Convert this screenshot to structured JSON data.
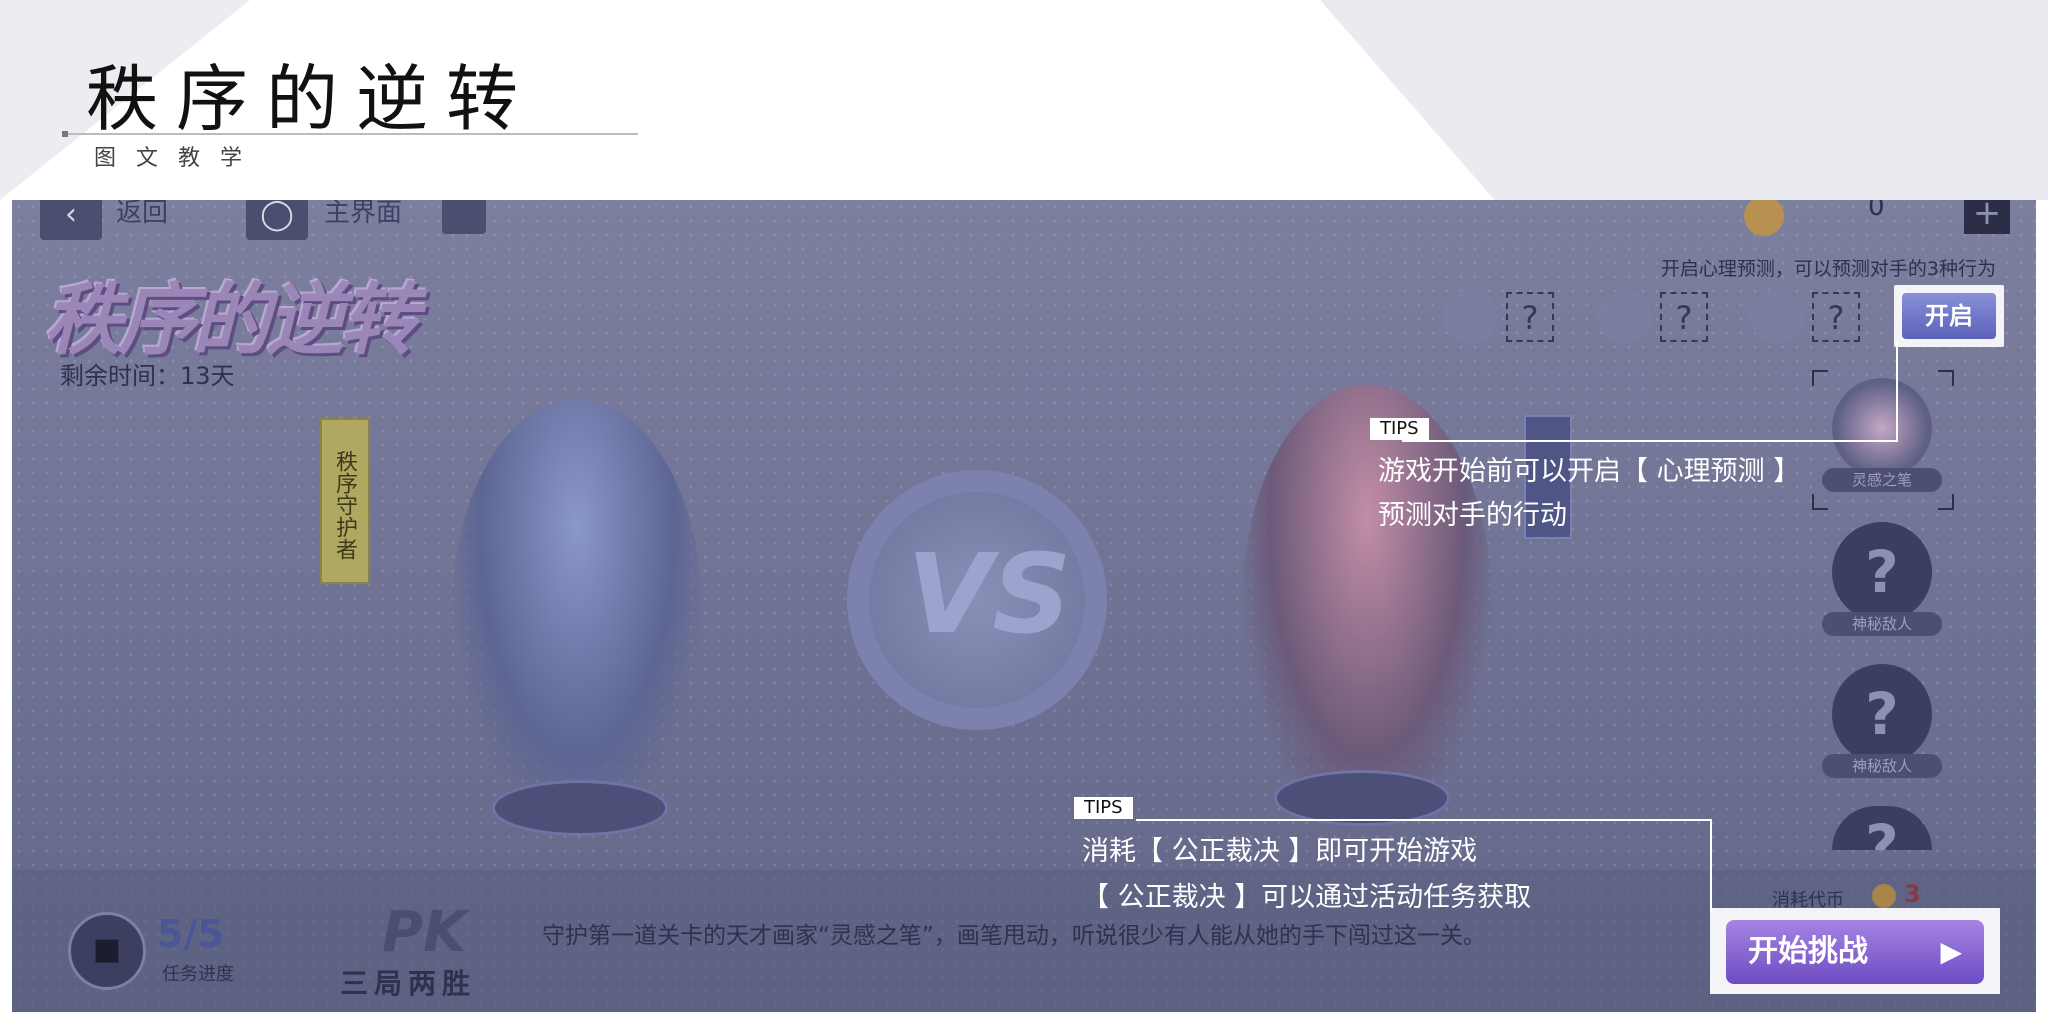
{
  "header": {
    "title": "秩序的逆转",
    "subtitle": "图文教学"
  },
  "topbar": {
    "back_label": "返回",
    "home_label": "主界面",
    "currency_value": "0",
    "plus": "+"
  },
  "event": {
    "logo": "秩序的逆转",
    "remaining": "剩余时间：13天",
    "guardian_tag": "秩序守护者"
  },
  "predict": {
    "hint": "开启心理预测，可以预测对手的3种行为",
    "unknown": "?",
    "open_label": "开启"
  },
  "vs": "VS",
  "enemies": {
    "top_name": "灵感之笔",
    "unknown_mark": "?",
    "unknown_name": "神秘敌人"
  },
  "bottom": {
    "progress": "5/5",
    "progress_label": "任务进度",
    "pk": "PK",
    "mode": "三局两胜",
    "description": "守护第一道关卡的天才画家“灵感之笔”，画笔甩动，听说很少有人能从她的手下闯过这一关。",
    "cost_label": "消耗代币",
    "cost_value": "3",
    "start_label": "开始挑战",
    "start_arrow": "▶"
  },
  "tips": [
    {
      "tag": "TIPS",
      "line1": "游戏开始前可以开启【 心理预测 】",
      "line2": "预测对手的行动"
    },
    {
      "tag": "TIPS",
      "line1": "消耗【 公正裁决 】即可开始游戏",
      "line2": "【 公正裁决 】可以通过活动任务获取"
    }
  ]
}
